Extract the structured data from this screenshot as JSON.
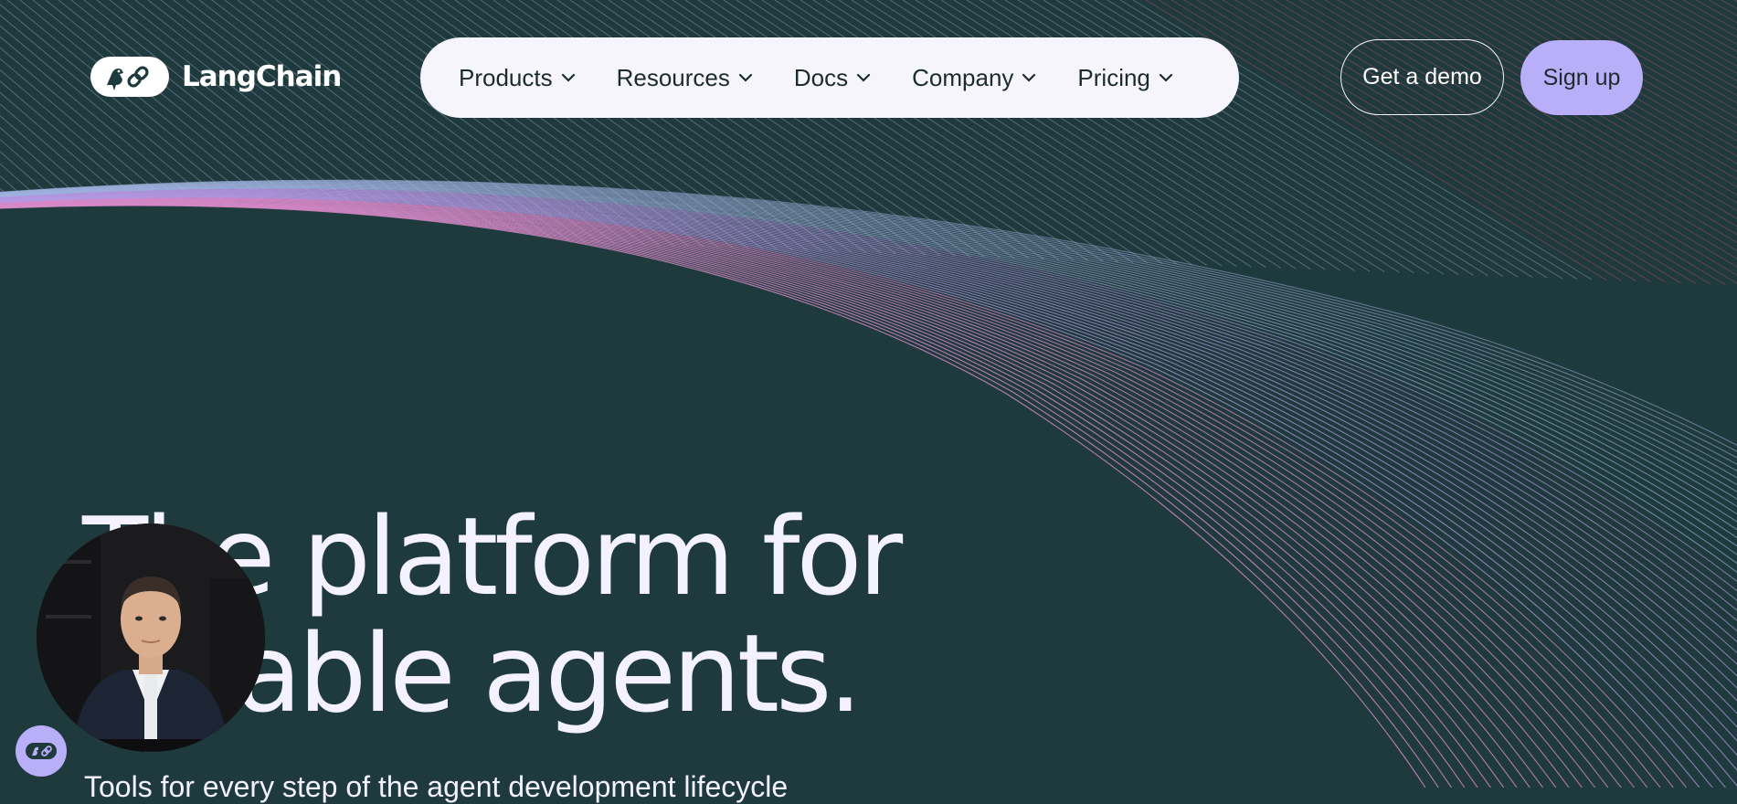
{
  "brand": {
    "name": "LangChain",
    "logo_icon": "langchain-parrot-link-icon"
  },
  "nav": {
    "items": [
      {
        "label": "Products",
        "icon": "chevron-down-icon"
      },
      {
        "label": "Resources",
        "icon": "chevron-down-icon"
      },
      {
        "label": "Docs",
        "icon": "chevron-down-icon"
      },
      {
        "label": "Company",
        "icon": "chevron-down-icon"
      },
      {
        "label": "Pricing",
        "icon": "chevron-down-icon"
      }
    ]
  },
  "actions": {
    "demo_label": "Get a demo",
    "signup_label": "Sign up"
  },
  "hero": {
    "title_line1": "The platform for",
    "title_line2": "reliable agents.",
    "subtitle": "Tools for every step of the agent development lifecycle"
  },
  "colors": {
    "background": "#1f3a3d",
    "nav_pill": "#f6f4fd",
    "accent": "#b9aef8",
    "text_light": "#f4f2ff",
    "text_dark": "#1c2b2d"
  },
  "widgets": {
    "video_bubble_icon": "presenter-video-avatar",
    "chat_launcher_icon": "langchain-chat-icon"
  }
}
